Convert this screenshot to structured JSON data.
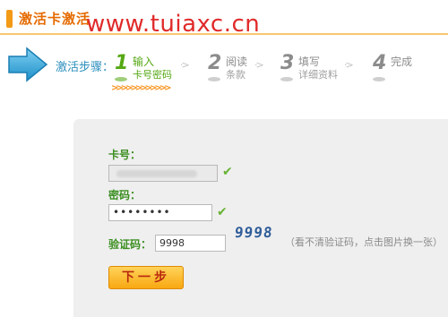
{
  "header": {
    "title": "激活卡激活",
    "watermark": "www.tuiaxc.cn",
    "accent_color": "#f39a16"
  },
  "steps": {
    "label": "激活步骤：",
    "separator": "·>",
    "items": [
      {
        "num": "1",
        "line1": "输入",
        "line2": "卡号密码",
        "state": "active"
      },
      {
        "num": "2",
        "line1": "阅读",
        "line2": "条款",
        "state": "inactive"
      },
      {
        "num": "3",
        "line1": "填写",
        "line2": "详细资料",
        "state": "inactive"
      },
      {
        "num": "4",
        "line1": "完成",
        "line2": "",
        "state": "inactive"
      }
    ],
    "progress": ">>>>>>>>>>>>",
    "icon": "arrow-right-icon"
  },
  "form": {
    "card_label": "卡号：",
    "card_value": "",
    "password_label": "密码：",
    "password_value": "••••••••",
    "captcha_label": "验证码：",
    "captcha_value": "9998",
    "captcha_image_text": "9998",
    "captcha_hint": "（看不清验证码，点击图片换一张）",
    "check_icon": "✔",
    "next_button": "下一步"
  }
}
